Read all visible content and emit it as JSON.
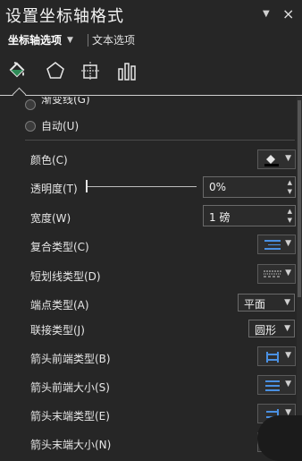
{
  "header": {
    "title": "设置坐标轴格式",
    "menu_glyph": "▼",
    "close_glyph": "×"
  },
  "subtabs": {
    "active": "坐标轴选项",
    "inactive": "文本选项"
  },
  "icon_tabs": [
    "fill-line-icon",
    "effects-pentagon-icon",
    "size-properties-icon",
    "axis-options-bar-icon"
  ],
  "accent": "#2e8b57",
  "line_options": {
    "gradient_line": "渐变线(G)",
    "automatic": "自动(U)"
  },
  "properties": {
    "color": {
      "label": "颜色(C)"
    },
    "transparency": {
      "label": "透明度(T)",
      "value": "0%",
      "level": 0
    },
    "width": {
      "label": "宽度(W)",
      "value": "1 磅"
    },
    "compound_type": {
      "label": "复合类型(C)"
    },
    "dash_type": {
      "label": "短划线类型(D)"
    },
    "cap_type": {
      "label": "端点类型(A)",
      "value": "平面"
    },
    "join_type": {
      "label": "联接类型(J)",
      "value": "圆形"
    },
    "begin_arrow_type": {
      "label": "箭头前端类型(B)"
    },
    "begin_arrow_size": {
      "label": "箭头前端大小(S)"
    },
    "end_arrow_type": {
      "label": "箭头末端类型(E)"
    },
    "end_arrow_size": {
      "label": "箭头末端大小(N)"
    }
  },
  "colors": {
    "background": "#262626",
    "icon_blue": "#4a90e2"
  }
}
